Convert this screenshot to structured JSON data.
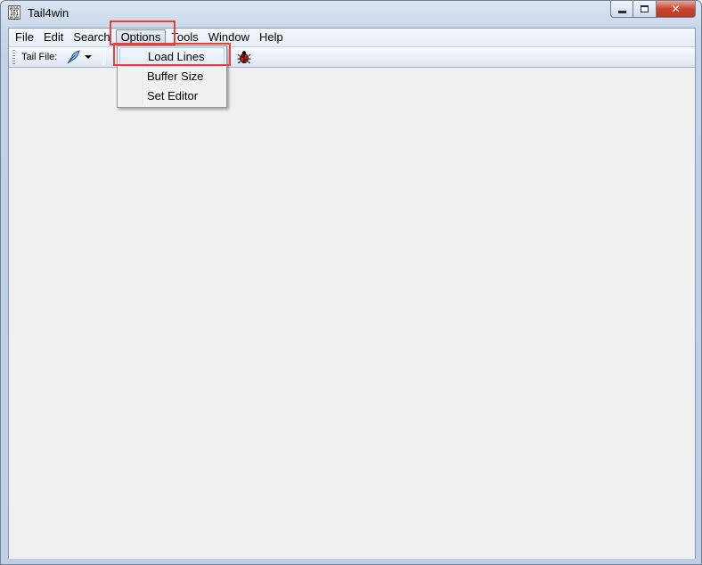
{
  "window": {
    "title": "Tail4win",
    "app_icon_text": "010\n101\n010",
    "close_glyph": "✕"
  },
  "menubar": {
    "items": [
      "File",
      "Edit",
      "Search",
      "Options",
      "Tools",
      "Window",
      "Help"
    ],
    "active": "Options"
  },
  "toolbar": {
    "tail_file_label": "Tail File:",
    "icons": [
      "feather-icon",
      "dropdown-arrow-icon",
      "bug-icon"
    ]
  },
  "options_menu": {
    "items": [
      "Load Lines",
      "Buffer Size",
      "Set Editor"
    ],
    "hovered": "Load Lines"
  },
  "colors": {
    "highlight": "#e8403f",
    "menu_hover_border": "#aecdf1",
    "close_button": "#c9452f"
  }
}
